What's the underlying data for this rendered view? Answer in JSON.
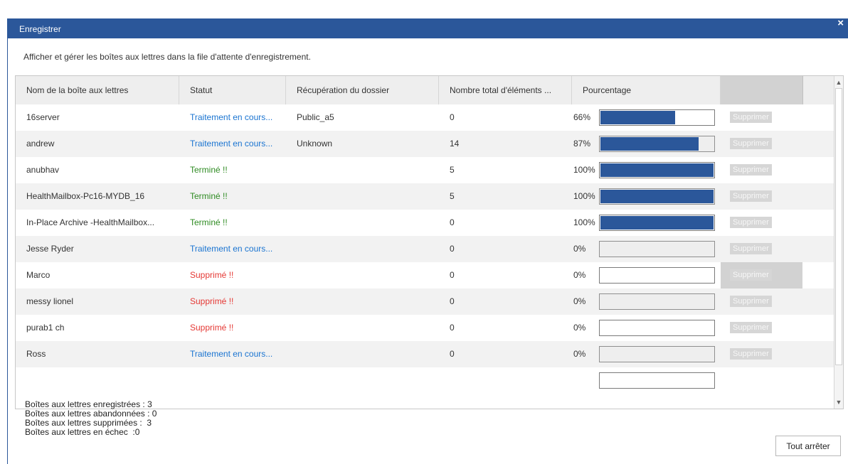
{
  "window": {
    "title": "Enregistrer",
    "close_label": "×"
  },
  "description": "Afficher et gérer les boîtes aux lettres dans la file d'attente d'enregistrement.",
  "table": {
    "headers": [
      "Nom de la boîte aux lettres",
      "Statut",
      "Récupération du dossier",
      "Nombre total d'éléments ...",
      "Pourcentage"
    ],
    "delete_label": "Supprimer",
    "rows": [
      {
        "name": "16server",
        "status": "Traitement en cours...",
        "status_type": "processing",
        "folder": "Public_a5",
        "total": "0",
        "percent_label": "66%",
        "percent": 66
      },
      {
        "name": "andrew",
        "status": "Traitement en cours...",
        "status_type": "processing",
        "folder": "Unknown",
        "total": "14",
        "percent_label": "87%",
        "percent": 87
      },
      {
        "name": "anubhav",
        "status": "Terminé !!",
        "status_type": "done",
        "folder": "",
        "total": "5",
        "percent_label": "100%",
        "percent": 100
      },
      {
        "name": "HealthMailbox-Pc16-MYDB_16",
        "status": "Terminé !!",
        "status_type": "done",
        "folder": "",
        "total": "5",
        "percent_label": "100%",
        "percent": 100
      },
      {
        "name": "In-Place Archive -HealthMailbox...",
        "status": "Terminé !!",
        "status_type": "done",
        "folder": "",
        "total": "0",
        "percent_label": "100%",
        "percent": 100
      },
      {
        "name": "Jesse Ryder",
        "status": "Traitement en cours...",
        "status_type": "processing",
        "folder": "",
        "total": "0",
        "percent_label": "0%",
        "percent": 0
      },
      {
        "name": "Marco",
        "status": "Supprimé !!",
        "status_type": "deleted",
        "folder": "",
        "total": "0",
        "percent_label": "0%",
        "percent": 0,
        "delete_hovered": true
      },
      {
        "name": "messy lionel",
        "status": "Supprimé !!",
        "status_type": "deleted",
        "folder": "",
        "total": "0",
        "percent_label": "0%",
        "percent": 0
      },
      {
        "name": "purab1 ch",
        "status": "Supprimé !!",
        "status_type": "deleted",
        "folder": "",
        "total": "0",
        "percent_label": "0%",
        "percent": 0
      },
      {
        "name": "Ross",
        "status": "Traitement en cours...",
        "status_type": "processing",
        "folder": "",
        "total": "0",
        "percent_label": "0%",
        "percent": 0
      },
      {
        "name": "",
        "status": "",
        "status_type": "processing",
        "folder": "",
        "total": "",
        "percent_label": "",
        "percent": 0
      }
    ]
  },
  "summary": [
    "Boîtes aux lettres enregistrées : 3",
    "Boîtes aux lettres abandonnées : 0",
    "Boîtes aux lettres supprimées :  3",
    "Boîtes aux lettres en échec  :0"
  ],
  "stop_all_label": "Tout arrêter",
  "colors": {
    "title_bar": "#2b579a",
    "progress_fill": "#2b579a",
    "status_processing": "#1a74d1",
    "status_done": "#2e8b22",
    "status_deleted": "#e53935"
  }
}
